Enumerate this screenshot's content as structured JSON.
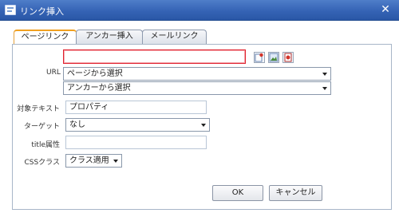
{
  "window": {
    "title": "リンク挿入",
    "close_glyph": "✕"
  },
  "tabs": [
    {
      "label": "ページリンク",
      "active": true
    },
    {
      "label": "アンカー挿入",
      "active": false
    },
    {
      "label": "メールリンク",
      "active": false
    }
  ],
  "form": {
    "url_label": "URL",
    "url_value": "",
    "page_select": "ページから選択",
    "anchor_select": "アンカーから選択",
    "target_text_label": "対象テキスト",
    "target_text_value": "プロパティ",
    "target_label": "ターゲット",
    "target_value": "なし",
    "title_attr_label": "title属性",
    "title_attr_value": "",
    "css_label": "CSSクラス",
    "css_value": "クラス適用"
  },
  "icons": [
    "link-icon",
    "image-icon",
    "file-icon"
  ],
  "buttons": {
    "ok": "OK",
    "cancel": "キャンセル"
  },
  "colors": {
    "titlebar": "#3563b5",
    "active_tab": "#f0a020",
    "error_border": "#e0212e"
  }
}
